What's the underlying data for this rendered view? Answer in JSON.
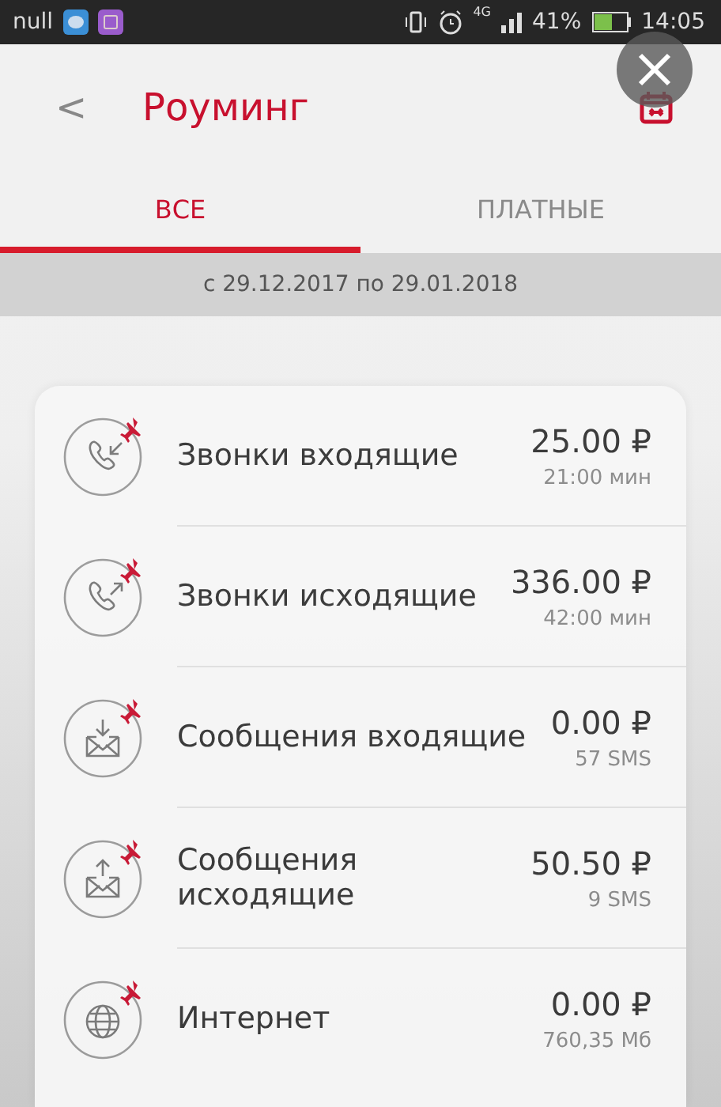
{
  "status_bar": {
    "carrier": "null",
    "network": "4G",
    "battery": "41%",
    "time": "14:05"
  },
  "header": {
    "back": "<",
    "title": "Роуминг"
  },
  "tabs": [
    {
      "label": "ВСЕ",
      "selected": true
    },
    {
      "label": "ПЛАТНЫЕ",
      "selected": false
    }
  ],
  "period": "с 29.12.2017 по 29.01.2018",
  "items": [
    {
      "kind": "call-in",
      "name": "Звонки входящие",
      "price": "25.00 ₽",
      "usage": "21:00 мин"
    },
    {
      "kind": "call-out",
      "name": "Звонки исходящие",
      "price": "336.00 ₽",
      "usage": "42:00 мин"
    },
    {
      "kind": "sms-in",
      "name": "Сообщения входящие",
      "price": "0.00 ₽",
      "usage": "57 SMS"
    },
    {
      "kind": "sms-out",
      "name": "Сообщения исходящие",
      "price": "50.50 ₽",
      "usage": "9 SMS"
    },
    {
      "kind": "internet",
      "name": "Интернет",
      "price": "0.00 ₽",
      "usage": "760,35 Мб"
    }
  ]
}
